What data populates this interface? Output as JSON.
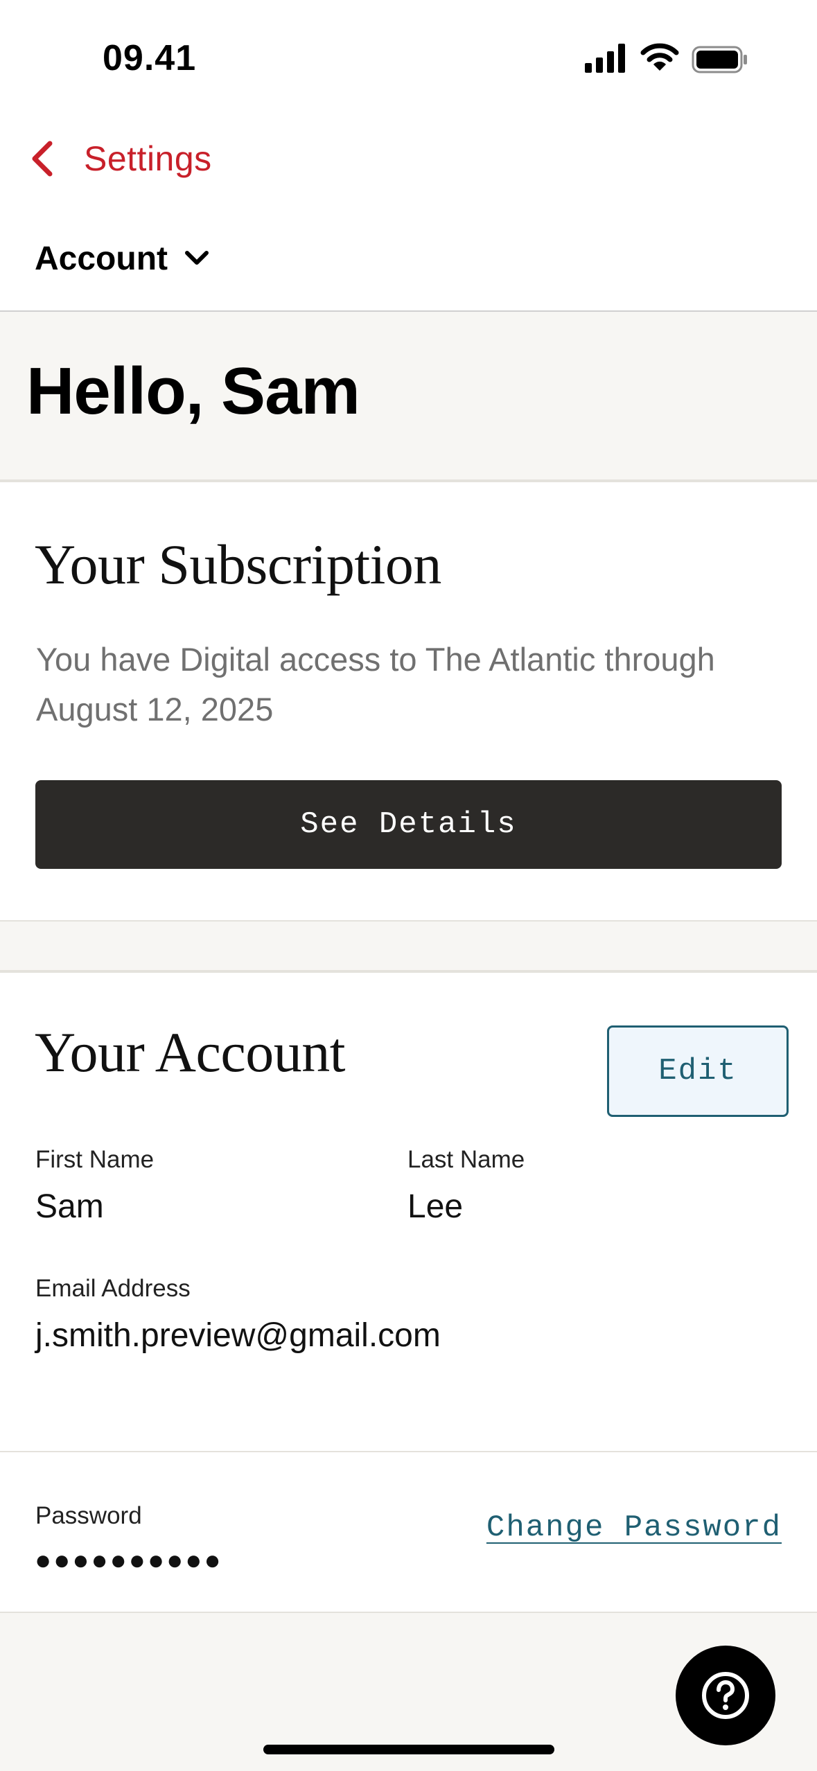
{
  "status_bar": {
    "time": "09.41"
  },
  "nav": {
    "back_label": "Settings"
  },
  "section_selector": {
    "label": "Account"
  },
  "greeting": "Hello, Sam",
  "subscription": {
    "title": "Your Subscription",
    "description": "You have Digital access to The Atlantic through August 12, 2025",
    "details_button": "See Details"
  },
  "account": {
    "title": "Your Account",
    "edit_button": "Edit",
    "first_name_label": "First Name",
    "first_name": "Sam",
    "last_name_label": "Last Name",
    "last_name": "Lee",
    "email_label": "Email Address",
    "email": "j.smith.preview@gmail.com",
    "password_label": "Password",
    "password_mask": "●●●●●●●●●●",
    "change_password": "Change Password"
  },
  "colors": {
    "accent_red": "#c8202a",
    "link_teal": "#1f5f72",
    "dark_button": "#2c2a28",
    "page_background": "#f7f6f3"
  },
  "icons": [
    "signal-icon",
    "wifi-icon",
    "battery-icon",
    "back-chevron-icon",
    "chevron-down-icon",
    "help-icon"
  ]
}
